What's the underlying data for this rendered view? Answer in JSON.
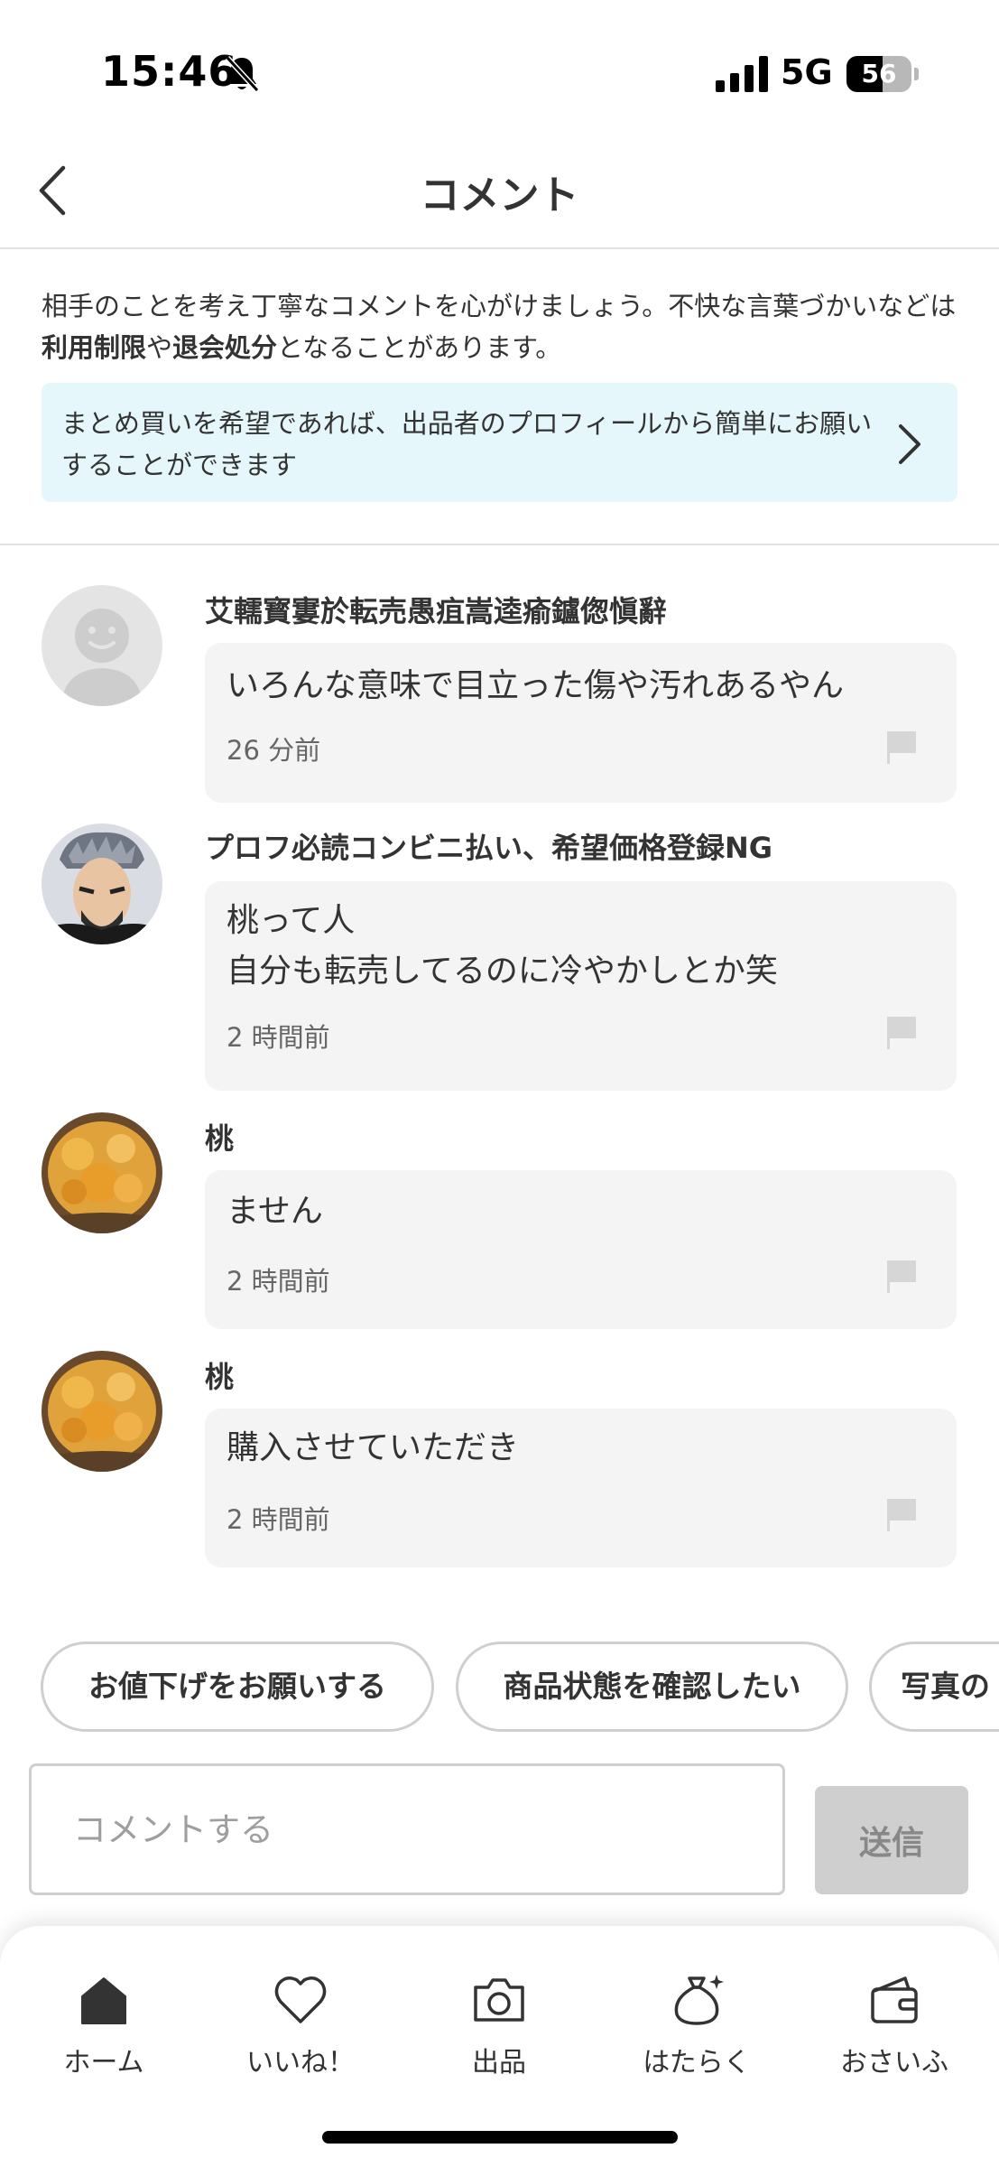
{
  "status_bar": {
    "time": "15:46",
    "network": "5G",
    "battery_level": "56",
    "battery_fraction": 0.56
  },
  "header": {
    "title": "コメント"
  },
  "notice": {
    "text_part1": "相手のことを考え丁寧なコメントを心がけましょう。不快な言葉づかいなどは",
    "bold1": "利用制限",
    "text_part2": "や",
    "bold2": "退会処分",
    "text_part3": "となることがあります。"
  },
  "info_banner": {
    "text": "まとめ買いを希望であれば、出品者のプロフィールから簡単にお願いすることができます"
  },
  "comments": [
    {
      "username": "艾轜寳寠於転売愚疽嵩逵瘉鑪偬愼辭",
      "text": "いろんな意味で目立った傷や汚れあるやん",
      "time": "26 分前"
    },
    {
      "username": "プロフ必読コンビニ払い、希望価格登録NG",
      "text": "桃って人\n自分も転売してるのに冷やかしとか笑",
      "time": "2 時間前"
    },
    {
      "username": "桃",
      "text": "ません",
      "time": "2 時間前"
    },
    {
      "username": "桃",
      "text": "購入させていただき",
      "time": "2 時間前"
    }
  ],
  "quick_replies": [
    "お値下げをお願いする",
    "商品状態を確認したい",
    "写真の"
  ],
  "input": {
    "placeholder": "コメントする",
    "send_label": "送信"
  },
  "bottom_nav": [
    {
      "label": "ホーム",
      "icon": "home-icon",
      "active": true
    },
    {
      "label": "いいね！",
      "icon": "heart-icon"
    },
    {
      "label": "出品",
      "icon": "camera-icon"
    },
    {
      "label": "はたらく",
      "icon": "money-bag-icon"
    },
    {
      "label": "おさいふ",
      "icon": "wallet-icon"
    }
  ],
  "colors": {
    "banner_bg": "#e6f7fc",
    "bubble_bg": "#f4f4f4",
    "send_disabled": "#cfcfcf"
  }
}
